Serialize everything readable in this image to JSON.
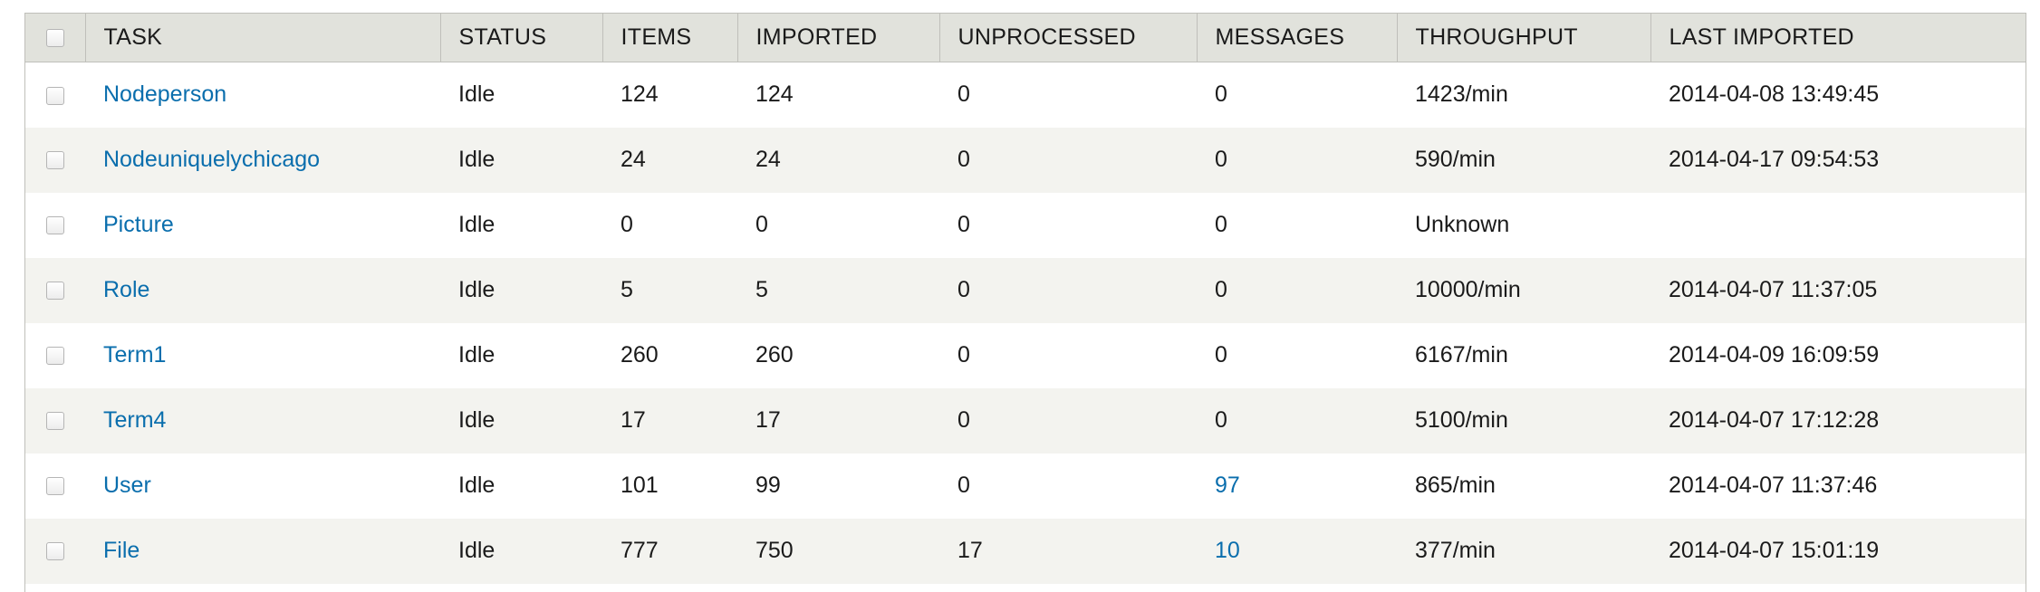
{
  "table": {
    "headers": {
      "task": "TASK",
      "status": "STATUS",
      "items": "ITEMS",
      "imported": "IMPORTED",
      "unprocessed": "UNPROCESSED",
      "messages": "MESSAGES",
      "throughput": "THROUGHPUT",
      "last_imported": "LAST IMPORTED"
    },
    "rows": [
      {
        "task": "Nodeperson",
        "status": "Idle",
        "items": "124",
        "imported": "124",
        "unprocessed": "0",
        "messages": "0",
        "throughput": "1423/min",
        "last_imported": "2014-04-08 13:49:45"
      },
      {
        "task": "Nodeuniquelychicago",
        "status": "Idle",
        "items": "24",
        "imported": "24",
        "unprocessed": "0",
        "messages": "0",
        "throughput": "590/min",
        "last_imported": "2014-04-17 09:54:53"
      },
      {
        "task": "Picture",
        "status": "Idle",
        "items": "0",
        "imported": "0",
        "unprocessed": "0",
        "messages": "0",
        "throughput": "Unknown",
        "last_imported": ""
      },
      {
        "task": "Role",
        "status": "Idle",
        "items": "5",
        "imported": "5",
        "unprocessed": "0",
        "messages": "0",
        "throughput": "10000/min",
        "last_imported": "2014-04-07 11:37:05"
      },
      {
        "task": "Term1",
        "status": "Idle",
        "items": "260",
        "imported": "260",
        "unprocessed": "0",
        "messages": "0",
        "throughput": "6167/min",
        "last_imported": "2014-04-09 16:09:59"
      },
      {
        "task": "Term4",
        "status": "Idle",
        "items": "17",
        "imported": "17",
        "unprocessed": "0",
        "messages": "0",
        "throughput": "5100/min",
        "last_imported": "2014-04-07 17:12:28"
      },
      {
        "task": "User",
        "status": "Idle",
        "items": "101",
        "imported": "99",
        "unprocessed": "0",
        "messages": "97",
        "throughput": "865/min",
        "last_imported": "2014-04-07 11:37:46"
      },
      {
        "task": "File",
        "status": "Idle",
        "items": "777",
        "imported": "750",
        "unprocessed": "17",
        "messages": "10",
        "throughput": "377/min",
        "last_imported": "2014-04-07 15:01:19"
      }
    ]
  },
  "colors": {
    "link": "#0a6ead",
    "header_bg": "#e1e2dc",
    "row_alt_bg": "#f3f3ef"
  }
}
